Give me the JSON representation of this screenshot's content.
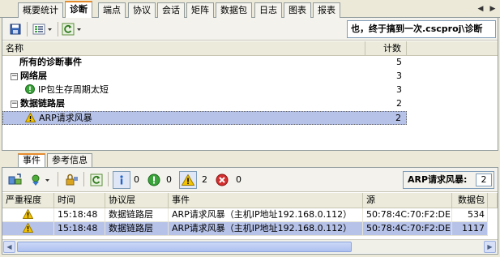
{
  "tabs": [
    {
      "label": "概要统计",
      "active": false
    },
    {
      "label": "诊断",
      "active": true
    },
    {
      "label": "端点",
      "active": false
    },
    {
      "label": "协议",
      "active": false
    },
    {
      "label": "会话",
      "active": false
    },
    {
      "label": "矩阵",
      "active": false
    },
    {
      "label": "数据包",
      "active": false
    },
    {
      "label": "日志",
      "active": false
    },
    {
      "label": "图表",
      "active": false
    },
    {
      "label": "报表",
      "active": false
    }
  ],
  "toolbar1": {
    "title_field": "也，终于搞到一次.cscproj\\诊断"
  },
  "diag_table": {
    "col_name": "名称",
    "col_count": "计数",
    "rows": [
      {
        "label": "所有的诊断事件",
        "count": "5",
        "bold": true,
        "indent": 0,
        "icon": "none",
        "expander": "none"
      },
      {
        "label": "网络层",
        "count": "3",
        "bold": true,
        "indent": 0,
        "icon": "none",
        "expander": "minus"
      },
      {
        "label": "IP包生存周期太短",
        "count": "3",
        "bold": false,
        "indent": 1,
        "icon": "info",
        "expander": "none"
      },
      {
        "label": "数据链路层",
        "count": "2",
        "bold": true,
        "indent": 0,
        "icon": "none",
        "expander": "minus"
      },
      {
        "label": "ARP请求风暴",
        "count": "2",
        "bold": false,
        "indent": 1,
        "icon": "warning",
        "expander": "none",
        "selected": true
      }
    ]
  },
  "bottom_tabs": [
    {
      "label": "事件",
      "active": true
    },
    {
      "label": "参考信息",
      "active": false
    }
  ],
  "toolbar2": {
    "info_count": "0",
    "ok_count": "0",
    "warn_count": "2",
    "error_count": "0",
    "filter_label": "ARP请求风暴:",
    "filter_value": "2"
  },
  "events_grid": {
    "headers": [
      "严重程度",
      "时间",
      "协议层",
      "事件",
      "源",
      "数据包"
    ],
    "rows": [
      {
        "severity": "warning",
        "time": "15:18:48",
        "layer": "数据链路层",
        "event": "ARP请求风暴（主机IP地址192.168.0.112）",
        "source": "50:78:4C:70:F2:DE",
        "packet": "534",
        "selected": false
      },
      {
        "severity": "warning",
        "time": "15:18:48",
        "layer": "数据链路层",
        "event": "ARP请求风暴（主机IP地址192.168.0.112）",
        "source": "50:78:4C:70:F2:DE",
        "packet": "1117",
        "selected": true
      }
    ]
  },
  "colors": {
    "accent_tab": "#e68b2c",
    "selection": "#b6c2e8",
    "warning": "#f5c400",
    "ok": "#3aa33a",
    "error": "#d32f2f",
    "info": "#2563c9"
  }
}
